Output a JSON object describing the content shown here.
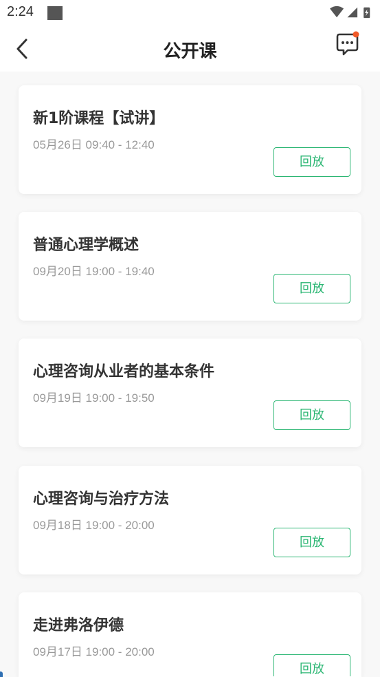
{
  "status_bar": {
    "time": "2:24"
  },
  "header": {
    "title": "公开课"
  },
  "colors": {
    "accent": "#2bb673",
    "notification_dot": "#f05a28",
    "title_text": "#333333",
    "time_text": "#999999"
  },
  "icons": {
    "back": "chevron-left-icon",
    "message": "chat-bubble-icon"
  },
  "courses": [
    {
      "title": "新1阶课程【试讲】",
      "time": "05月26日 09:40 - 12:40",
      "action": "回放"
    },
    {
      "title": "普通心理学概述",
      "time": "09月20日 19:00 - 19:40",
      "action": "回放"
    },
    {
      "title": "心理咨询从业者的基本条件",
      "time": "09月19日 19:00 - 19:50",
      "action": "回放"
    },
    {
      "title": "心理咨询与治疗方法",
      "time": "09月18日 19:00 - 20:00",
      "action": "回放"
    },
    {
      "title": "走进弗洛伊德",
      "time": "09月17日 19:00 - 20:00",
      "action": "回放"
    }
  ]
}
